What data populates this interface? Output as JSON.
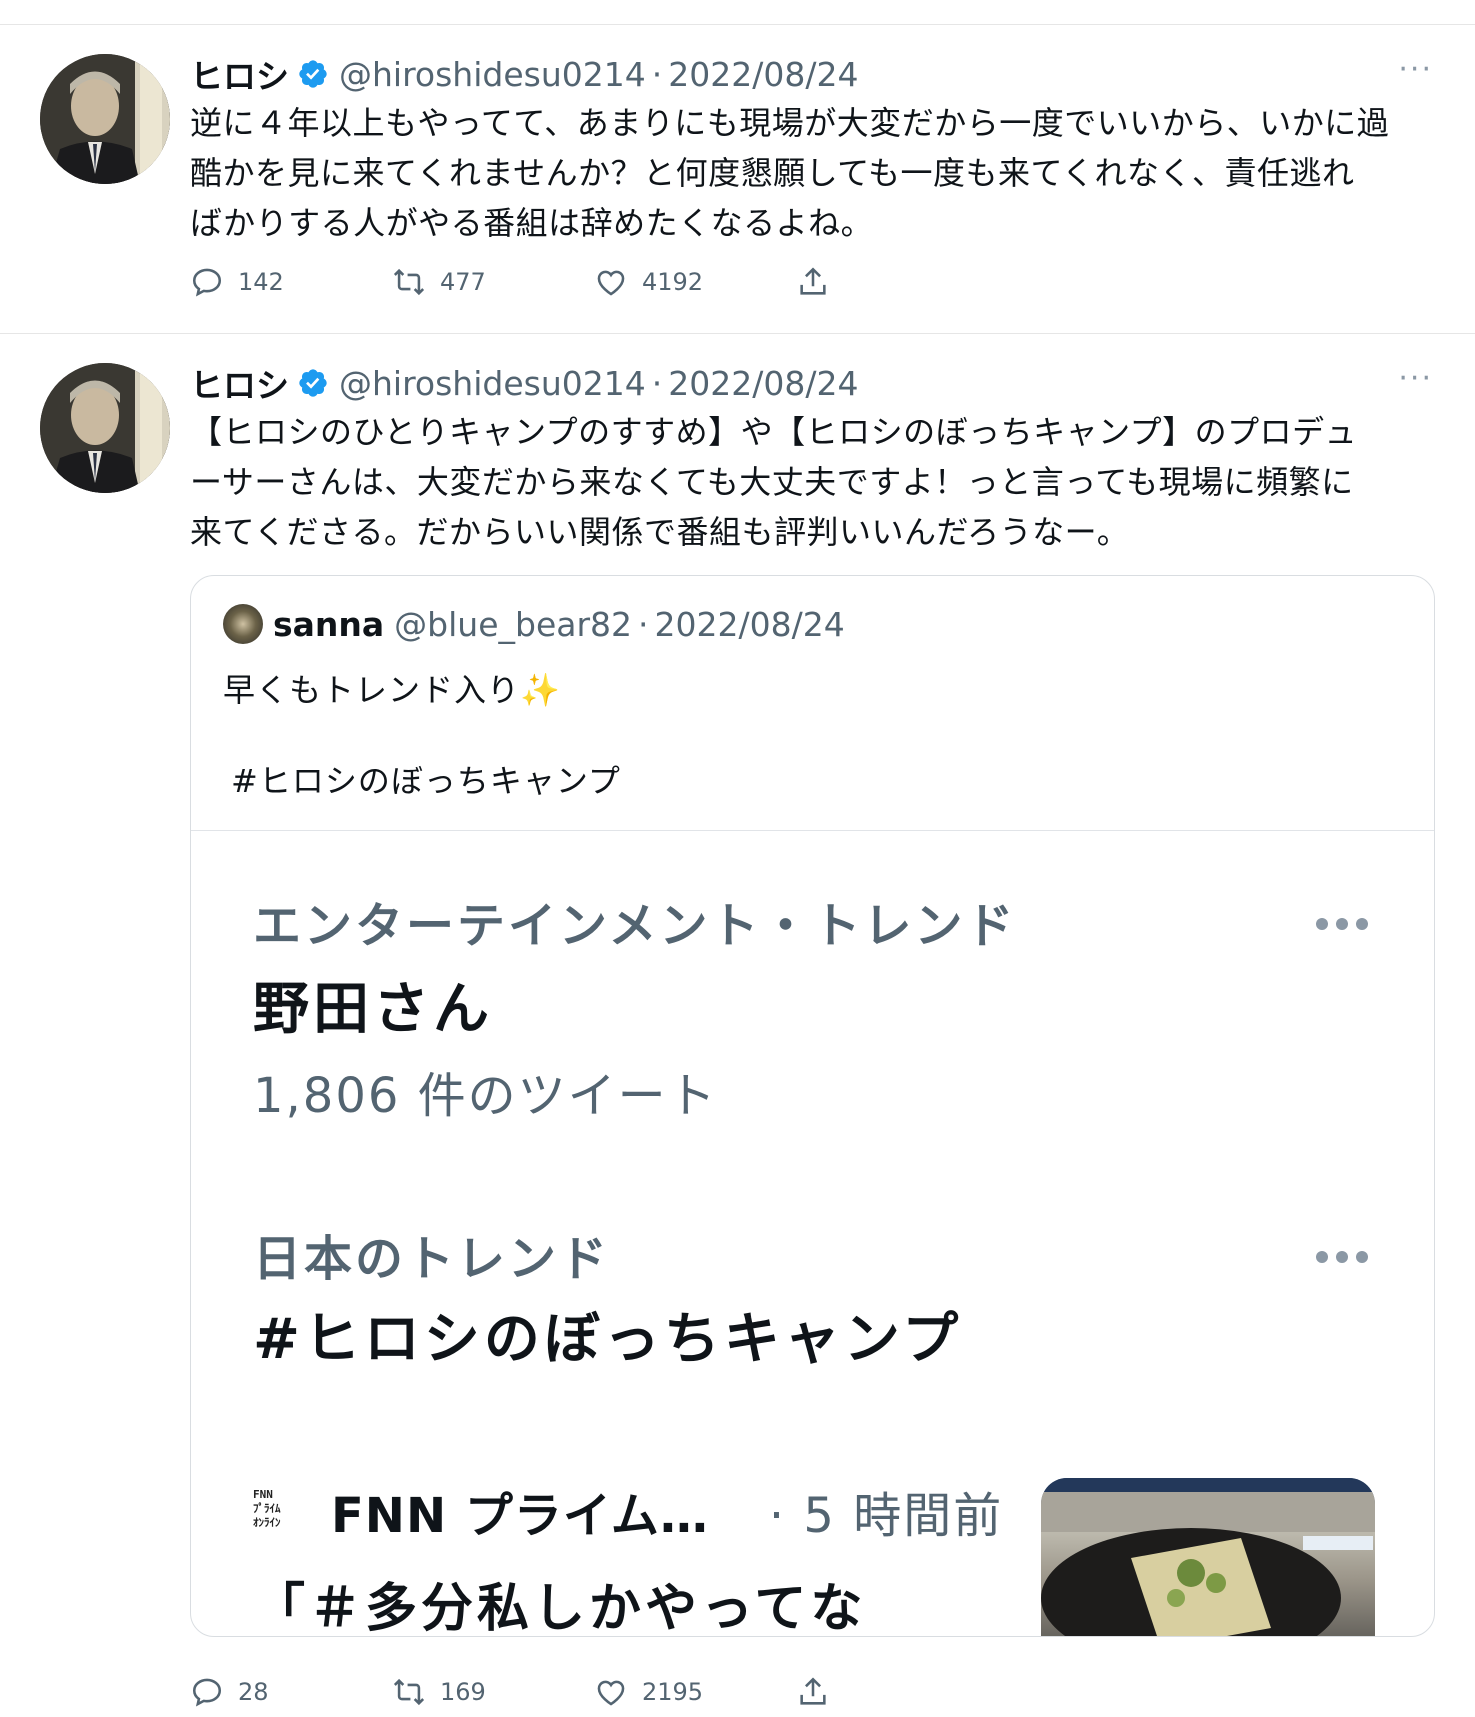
{
  "tweets": [
    {
      "name": "ヒロシ",
      "handle": "@hiroshidesu0214",
      "sep": "·",
      "date": "2022/08/24",
      "more": "···",
      "body_lines": [
        "逆に４年以上もやってて、あまりにも現場が大変だから一度でいいから、いかに過",
        "酷かを見に来てくれませんか？と何度懇願しても一度も来てくれなく、責任逃れ",
        "ばかりする人がやる番組は辞めたくなるよね。"
      ],
      "replies": "142",
      "retweets": "477",
      "likes": "4192"
    },
    {
      "name": "ヒロシ",
      "handle": "@hiroshidesu0214",
      "sep": "·",
      "date": "2022/08/24",
      "more": "···",
      "body_lines": [
        "【ヒロシのひとりキャンプのすすめ】や【ヒロシのぼっちキャンプ】のプロデュ",
        "ーサーさんは、大変だから来なくても大丈夫ですよ！っと言っても現場に頻繁に",
        "来てくださる。だからいい関係で番組も評判いいんだろうなー。"
      ],
      "replies": "28",
      "retweets": "169",
      "likes": "2195",
      "quote": {
        "name": "sanna",
        "handle": "@blue_bear82",
        "sep": "·",
        "date": "2022/08/24",
        "text": "早くもトレンド入り✨",
        "hashtag": "#ヒロシのぼっちキャンプ",
        "trend1": {
          "label": "エンターテインメント・トレンド",
          "title": "野田さん",
          "count": "1,806 件のツイート"
        },
        "trend2": {
          "label": "日本のトレンド",
          "title": "#ヒロシのぼっちキャンプ"
        },
        "news": {
          "logo_lines": [
            "FNN",
            "ﾌﾟﾗｲﾑ",
            "ｵﾝﾗｲﾝ"
          ],
          "source": "FNN プライム…",
          "time": "· 5 時間前",
          "title": "「＃多分私しかやってな"
        }
      }
    }
  ],
  "colors": {
    "text": "#0f1419",
    "secondary": "#536471",
    "verified": "#1d9bf0",
    "border": "#d9dde1"
  },
  "icons": [
    "verified-badge-icon",
    "reply-icon",
    "retweet-icon",
    "like-icon",
    "share-icon",
    "more-icon"
  ]
}
